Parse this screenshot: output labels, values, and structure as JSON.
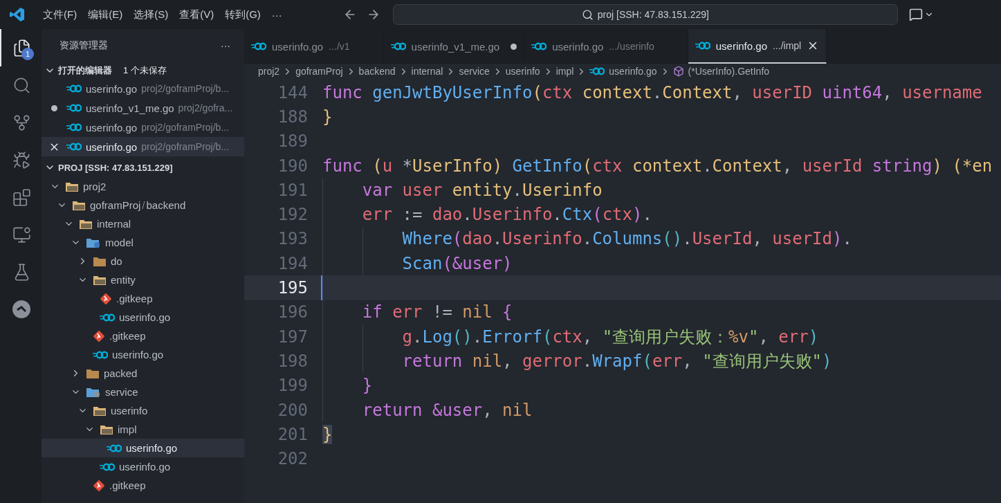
{
  "title_bar": {
    "menu": [
      "文件(F)",
      "编辑(E)",
      "选择(S)",
      "查看(V)",
      "转到(G)"
    ],
    "more": "···",
    "search": "proj [SSH: 47.83.151.229]"
  },
  "activity_bar": {
    "items": [
      {
        "kind": "files",
        "selected": true,
        "badge": "1"
      },
      {
        "kind": "search",
        "selected": false
      },
      {
        "kind": "source-control",
        "selected": false
      },
      {
        "kind": "debug",
        "selected": false
      },
      {
        "kind": "extensions",
        "selected": false
      },
      {
        "kind": "remote",
        "selected": false
      },
      {
        "kind": "testing",
        "selected": false
      },
      {
        "kind": "lens",
        "selected": false
      }
    ]
  },
  "sidebar": {
    "title": "资源管理器",
    "more": "···",
    "open_editors": {
      "title": "打开的编辑器",
      "status": "1 个未保存",
      "expanded": true,
      "items": [
        {
          "name": "userinfo.go",
          "path": "proj2/goframProj/b...",
          "dirty": false,
          "selected": false
        },
        {
          "name": "userinfo_v1_me.go",
          "path": "proj2/gofra...",
          "dirty": true,
          "selected": false
        },
        {
          "name": "userinfo.go",
          "path": "proj2/goframProj/b...",
          "dirty": false,
          "selected": false
        },
        {
          "name": "userinfo.go",
          "path": "proj2/goframProj/b...",
          "dirty": false,
          "selected": true
        }
      ]
    },
    "project": {
      "title": "PROJ [SSH: 47.83.151.229]",
      "expanded": true,
      "tree": [
        {
          "name": "proj2",
          "kind": "folder",
          "expanded": true,
          "selected": false,
          "children": [
            {
              "name": "goframProj",
              "separator": "/",
              "name_2": "backend",
              "kind": "folder",
              "expanded": true,
              "selected": false,
              "children": [
                {
                  "name": "internal",
                  "kind": "folder",
                  "expanded": true,
                  "selected": false,
                  "children": [
                    {
                      "name": "model",
                      "kind": "model",
                      "expanded": true,
                      "selected": false,
                      "children": [
                        {
                          "name": "do",
                          "kind": "folder",
                          "expanded": false,
                          "selected": false
                        },
                        {
                          "name": "entity",
                          "kind": "folder",
                          "expanded": true,
                          "selected": false,
                          "children": [
                            {
                              "name": ".gitkeep",
                              "kind": "git",
                              "selected": false
                            },
                            {
                              "name": "userinfo.go",
                              "kind": "go",
                              "selected": false
                            }
                          ]
                        },
                        {
                          "name": ".gitkeep",
                          "kind": "git",
                          "selected": false
                        },
                        {
                          "name": "userinfo.go",
                          "kind": "go",
                          "selected": false
                        }
                      ]
                    },
                    {
                      "name": "packed",
                      "kind": "folder",
                      "expanded": false,
                      "selected": false
                    },
                    {
                      "name": "service",
                      "kind": "service",
                      "expanded": true,
                      "selected": false,
                      "children": [
                        {
                          "name": "userinfo",
                          "kind": "folder",
                          "expanded": true,
                          "selected": false,
                          "children": [
                            {
                              "name": "impl",
                              "kind": "folder",
                              "expanded": true,
                              "selected": false,
                              "children": [
                                {
                                  "name": "userinfo.go",
                                  "kind": "go",
                                  "selected": true
                                }
                              ]
                            },
                            {
                              "name": "userinfo.go",
                              "kind": "go",
                              "selected": false
                            }
                          ]
                        },
                        {
                          "name": ".gitkeep",
                          "kind": "git",
                          "selected": false
                        }
                      ]
                    }
                  ]
                }
              ]
            }
          ]
        }
      ]
    }
  },
  "tabs": [
    {
      "name": "userinfo.go",
      "path": ".../v1",
      "dirty": false,
      "selected": false
    },
    {
      "name": "userinfo_v1_me.go",
      "dirty": true,
      "selected": false
    },
    {
      "name": "userinfo.go",
      "path": ".../userinfo",
      "dirty": false,
      "selected": false
    },
    {
      "name": "userinfo.go",
      "path": ".../impl",
      "dirty": false,
      "selected": true
    }
  ],
  "breadcrumb": [
    {
      "kind": "folder",
      "label": "proj2"
    },
    {
      "kind": "folder",
      "label": "goframProj"
    },
    {
      "kind": "folder",
      "label": "backend"
    },
    {
      "kind": "folder",
      "label": "internal"
    },
    {
      "kind": "folder",
      "label": "service"
    },
    {
      "kind": "folder",
      "label": "userinfo"
    },
    {
      "kind": "folder",
      "label": "impl"
    },
    {
      "kind": "file",
      "label": "userinfo.go"
    },
    {
      "kind": "symbol",
      "label": "(*UserInfo).GetInfo"
    }
  ],
  "editor": {
    "lines": [
      {
        "number": "144",
        "current": false,
        "tokens": [
          {
            "kind": "kw",
            "text": "func "
          },
          {
            "kind": "fn",
            "text": "genJwtByUserInfo"
          },
          {
            "kind": "b1",
            "text": "("
          },
          {
            "kind": "var",
            "text": "ctx "
          },
          {
            "kind": "type",
            "text": "context"
          },
          {
            "kind": "plain",
            "text": "."
          },
          {
            "kind": "type",
            "text": "Context"
          },
          {
            "kind": "plain",
            "text": ", "
          },
          {
            "kind": "var",
            "text": "userID "
          },
          {
            "kind": "kw",
            "text": "uint64"
          },
          {
            "kind": "plain",
            "text": ", "
          },
          {
            "kind": "var",
            "text": "username"
          }
        ]
      },
      {
        "number": "188",
        "current": false,
        "tokens": [
          {
            "kind": "b1",
            "text": "}"
          }
        ]
      },
      {
        "number": "189",
        "current": false
      },
      {
        "number": "190",
        "current": false,
        "tokens": [
          {
            "kind": "kw",
            "text": "func "
          },
          {
            "kind": "b1",
            "text": "("
          },
          {
            "kind": "var",
            "text": "u "
          },
          {
            "kind": "plain",
            "text": "*"
          },
          {
            "kind": "type",
            "text": "UserInfo"
          },
          {
            "kind": "b1",
            "text": ") "
          },
          {
            "kind": "fn",
            "text": "GetInfo"
          },
          {
            "kind": "b1",
            "text": "("
          },
          {
            "kind": "var",
            "text": "ctx "
          },
          {
            "kind": "type",
            "text": "context"
          },
          {
            "kind": "plain",
            "text": "."
          },
          {
            "kind": "type",
            "text": "Context"
          },
          {
            "kind": "plain",
            "text": ", "
          },
          {
            "kind": "var",
            "text": "userId "
          },
          {
            "kind": "kw",
            "text": "string"
          },
          {
            "kind": "b1",
            "text": ") "
          },
          {
            "kind": "b1",
            "text": "(*en"
          }
        ]
      },
      {
        "number": "191",
        "current": false,
        "tokens": [
          {
            "kind": "ws"
          },
          {
            "kind": "kw",
            "text": "var "
          },
          {
            "kind": "var",
            "text": "user "
          },
          {
            "kind": "type",
            "text": "entity"
          },
          {
            "kind": "plain",
            "text": "."
          },
          {
            "kind": "type",
            "text": "Userinfo"
          }
        ]
      },
      {
        "number": "192",
        "current": false,
        "tokens": [
          {
            "kind": "ws"
          },
          {
            "kind": "var",
            "text": "err "
          },
          {
            "kind": "plain",
            "text": ":= "
          },
          {
            "kind": "var",
            "text": "dao"
          },
          {
            "kind": "plain",
            "text": "."
          },
          {
            "kind": "var",
            "text": "Userinfo"
          },
          {
            "kind": "plain",
            "text": "."
          },
          {
            "kind": "fn",
            "text": "Ctx"
          },
          {
            "kind": "b2",
            "text": "("
          },
          {
            "kind": "var",
            "text": "ctx"
          },
          {
            "kind": "b2",
            "text": ")"
          },
          {
            "kind": "plain",
            "text": "."
          }
        ]
      },
      {
        "number": "193",
        "current": false,
        "tokens": [
          {
            "kind": "ws"
          },
          {
            "kind": "ws"
          },
          {
            "kind": "fn",
            "text": "Where"
          },
          {
            "kind": "b2",
            "text": "("
          },
          {
            "kind": "var",
            "text": "dao"
          },
          {
            "kind": "plain",
            "text": "."
          },
          {
            "kind": "var",
            "text": "Userinfo"
          },
          {
            "kind": "plain",
            "text": "."
          },
          {
            "kind": "fn",
            "text": "Columns"
          },
          {
            "kind": "b3",
            "text": "()"
          },
          {
            "kind": "plain",
            "text": "."
          },
          {
            "kind": "var",
            "text": "UserId"
          },
          {
            "kind": "plain",
            "text": ", "
          },
          {
            "kind": "var",
            "text": "userId"
          },
          {
            "kind": "b2",
            "text": ")"
          },
          {
            "kind": "plain",
            "text": "."
          }
        ]
      },
      {
        "number": "194",
        "current": false,
        "tokens": [
          {
            "kind": "ws"
          },
          {
            "kind": "ws"
          },
          {
            "kind": "fn",
            "text": "Scan"
          },
          {
            "kind": "b2",
            "text": "("
          },
          {
            "kind": "b2",
            "text": "&user"
          },
          {
            "kind": "b2",
            "text": ")"
          }
        ]
      },
      {
        "number": "195",
        "current": true,
        "tokens": [
          {
            "kind": "ws"
          }
        ]
      },
      {
        "number": "196",
        "current": false,
        "tokens": [
          {
            "kind": "ws"
          },
          {
            "kind": "kw",
            "text": "if "
          },
          {
            "kind": "var",
            "text": "err "
          },
          {
            "kind": "plain",
            "text": "!= "
          },
          {
            "kind": "num",
            "text": "nil "
          },
          {
            "kind": "b2",
            "text": "{"
          }
        ]
      },
      {
        "number": "197",
        "current": false,
        "tokens": [
          {
            "kind": "ws"
          },
          {
            "kind": "ws"
          },
          {
            "kind": "var",
            "text": "g"
          },
          {
            "kind": "plain",
            "text": "."
          },
          {
            "kind": "fn",
            "text": "Log"
          },
          {
            "kind": "b3",
            "text": "()"
          },
          {
            "kind": "plain",
            "text": "."
          },
          {
            "kind": "fn",
            "text": "Errorf"
          },
          {
            "kind": "b3",
            "text": "("
          },
          {
            "kind": "var",
            "text": "ctx"
          },
          {
            "kind": "plain",
            "text": ", "
          },
          {
            "kind": "str",
            "text": "\"查询用户失败："
          },
          {
            "kind": "num",
            "text": "%v"
          },
          {
            "kind": "str",
            "text": "\""
          },
          {
            "kind": "plain",
            "text": ", "
          },
          {
            "kind": "var",
            "text": "err"
          },
          {
            "kind": "b3",
            "text": ")"
          }
        ]
      },
      {
        "number": "198",
        "current": false,
        "tokens": [
          {
            "kind": "ws"
          },
          {
            "kind": "ws"
          },
          {
            "kind": "kw",
            "text": "return "
          },
          {
            "kind": "num",
            "text": "nil"
          },
          {
            "kind": "plain",
            "text": ", "
          },
          {
            "kind": "var",
            "text": "gerror"
          },
          {
            "kind": "plain",
            "text": "."
          },
          {
            "kind": "fn",
            "text": "Wrapf"
          },
          {
            "kind": "b3",
            "text": "("
          },
          {
            "kind": "var",
            "text": "err"
          },
          {
            "kind": "plain",
            "text": ", "
          },
          {
            "kind": "str",
            "text": "\"查询用户失败\""
          },
          {
            "kind": "b3",
            "text": ")"
          }
        ]
      },
      {
        "number": "199",
        "current": false,
        "tokens": [
          {
            "kind": "ws"
          },
          {
            "kind": "b2",
            "text": "}"
          }
        ]
      },
      {
        "number": "200",
        "current": false,
        "tokens": [
          {
            "kind": "ws"
          },
          {
            "kind": "kw",
            "text": "return "
          },
          {
            "kind": "kw",
            "text": "&user"
          },
          {
            "kind": "plain",
            "text": ", "
          },
          {
            "kind": "num",
            "text": "nil"
          }
        ]
      },
      {
        "number": "201",
        "current": false,
        "tokens": [
          {
            "kind": "b1",
            "text": "}",
            "match": true
          }
        ]
      },
      {
        "number": "202",
        "current": false
      }
    ]
  }
}
